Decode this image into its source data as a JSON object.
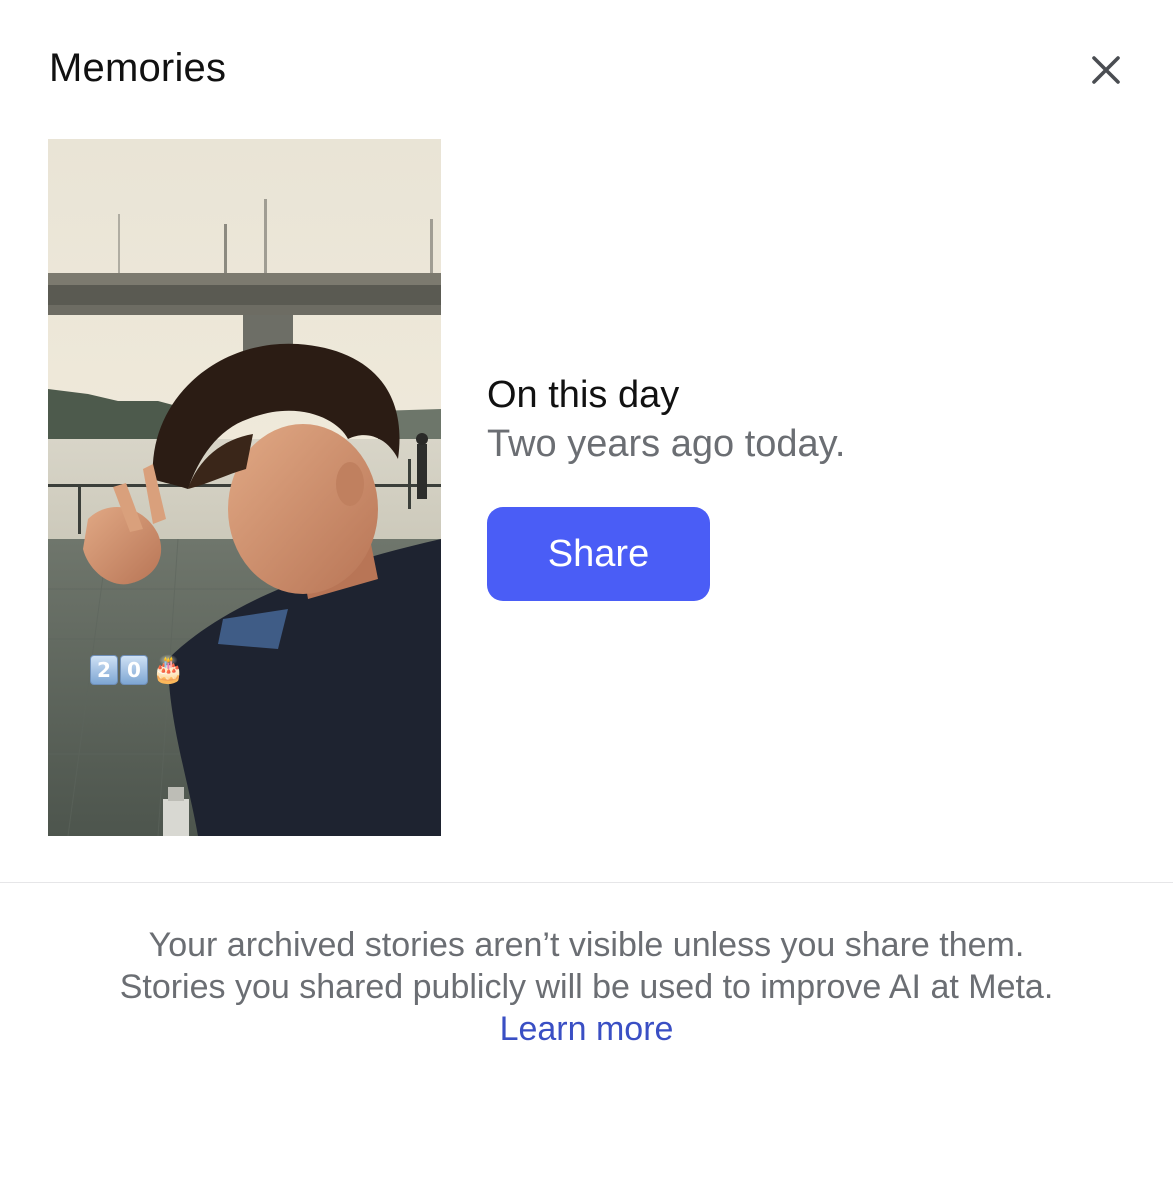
{
  "header": {
    "title": "Memories",
    "close_icon": "close-icon"
  },
  "memory": {
    "title": "On this day",
    "subtitle": "Two years ago today.",
    "share_label": "Share",
    "photo_badge": {
      "digits": [
        "2",
        "0"
      ],
      "emoji": "🎂"
    }
  },
  "footer": {
    "line1": "Your archived stories aren’t visible unless you share them.",
    "line2": "Stories you shared publicly will be used to improve AI at Meta.",
    "link_label": "Learn more"
  },
  "colors": {
    "share_button": "#4a5df6",
    "link": "#3a4fc4",
    "muted_text": "#6b6e73"
  }
}
